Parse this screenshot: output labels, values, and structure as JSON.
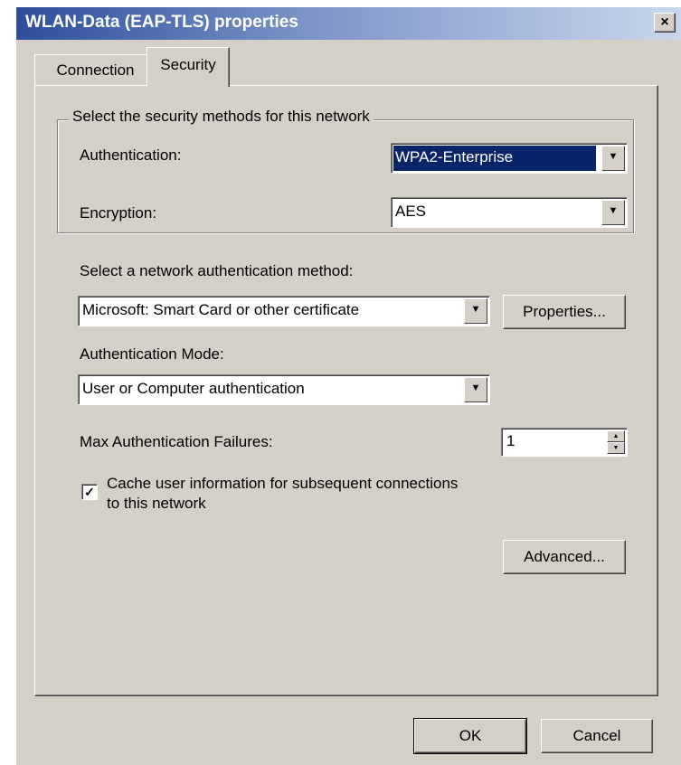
{
  "window": {
    "title": "WLAN-Data (EAP-TLS) properties",
    "close_glyph": "×"
  },
  "tabs": [
    {
      "label": "Connection"
    },
    {
      "label": "Security"
    }
  ],
  "security_group": {
    "legend": "Select the security methods for this network",
    "authentication_label": "Authentication:",
    "authentication_value": "WPA2-Enterprise",
    "encryption_label": "Encryption:",
    "encryption_value": "AES"
  },
  "network_auth": {
    "label": "Select a network authentication method:",
    "value": "Microsoft: Smart Card or other certificate",
    "properties_button": "Properties..."
  },
  "auth_mode": {
    "label": "Authentication Mode:",
    "value": "User or Computer authentication"
  },
  "max_failures": {
    "label": "Max Authentication Failures:",
    "value": "1"
  },
  "cache": {
    "checked": true,
    "check_glyph": "✓",
    "label_line1": "Cache user information for subsequent connections",
    "label_line2": "to this network"
  },
  "advanced_button": "Advanced...",
  "footer": {
    "ok": "OK",
    "cancel": "Cancel"
  },
  "glyphs": {
    "dropdown": "▼",
    "spin_up": "▲",
    "spin_down": "▼"
  }
}
